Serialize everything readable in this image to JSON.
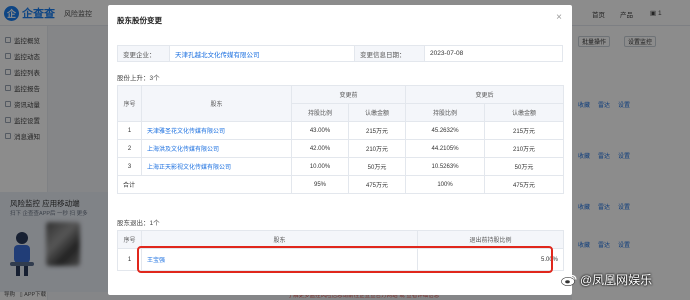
{
  "app": {
    "logo_mark": "企",
    "logo_text": "企查查",
    "nav_label": "风险监控",
    "top_links": [
      "首页",
      "产品",
      "▣ 1"
    ],
    "sidebar": [
      "监控概览",
      "监控动态",
      "监控列表",
      "监控报告",
      "资讯动量",
      "监控设置",
      "消息通知"
    ],
    "promo_title": "风险监控 应用移动端",
    "promo_sub": "扫下 企查查APP后 一秒 扫 更多",
    "bottom_links": [
      "导购",
      "APP下载"
    ],
    "right_buttons": [
      "批量操作",
      "设置监控"
    ],
    "row_links": [
      "收藏",
      "雷达",
      "设置"
    ],
    "bottom_note": "* 了解更多监控风险信息请前往企查查官方网站 或 查看详细信息"
  },
  "modal": {
    "title": "股东股份变更",
    "close": "×",
    "info": {
      "company_label": "变更企业：",
      "company": "天津孔越北文化传媒有限公司",
      "date_label": "变更信息日期：",
      "date": "2023-07-08"
    },
    "added_label": "股份上升：3个",
    "added_table": {
      "group_before": "变更前",
      "group_after": "变更后",
      "col_index": "序号",
      "col_shareholder": "股东",
      "col_ratio": "持股比例",
      "col_amount": "认缴金额",
      "rows": [
        {
          "index": "1",
          "name": "天津雅圣花文化传媒有限公司",
          "before_ratio": "43.00%",
          "before_amount": "215万元",
          "after_ratio": "45.2632%",
          "after_amount": "215万元"
        },
        {
          "index": "2",
          "name": "上海洪及文化传媒有限公司",
          "before_ratio": "42.00%",
          "before_amount": "210万元",
          "after_ratio": "44.2105%",
          "after_amount": "210万元"
        },
        {
          "index": "3",
          "name": "上海正天影视文化传媒有限公司",
          "before_ratio": "10.00%",
          "before_amount": "50万元",
          "after_ratio": "10.5263%",
          "after_amount": "50万元"
        }
      ],
      "total": {
        "label": "合计",
        "before_ratio": "95%",
        "before_amount": "475万元",
        "after_ratio": "100%",
        "after_amount": "475万元"
      }
    },
    "removed_label": "股东退出：1个",
    "removed_table": {
      "col_index": "序号",
      "col_shareholder": "股东",
      "col_ratio": "退出前持股比例",
      "rows": [
        {
          "index": "1",
          "name": "王宝强",
          "ratio": "5.00%"
        }
      ]
    }
  },
  "watermark": {
    "text": "@凤凰网娱乐"
  },
  "colors": {
    "accent": "#1a7ef0",
    "link": "#1a6fe0",
    "highlight": "#e0271c"
  }
}
